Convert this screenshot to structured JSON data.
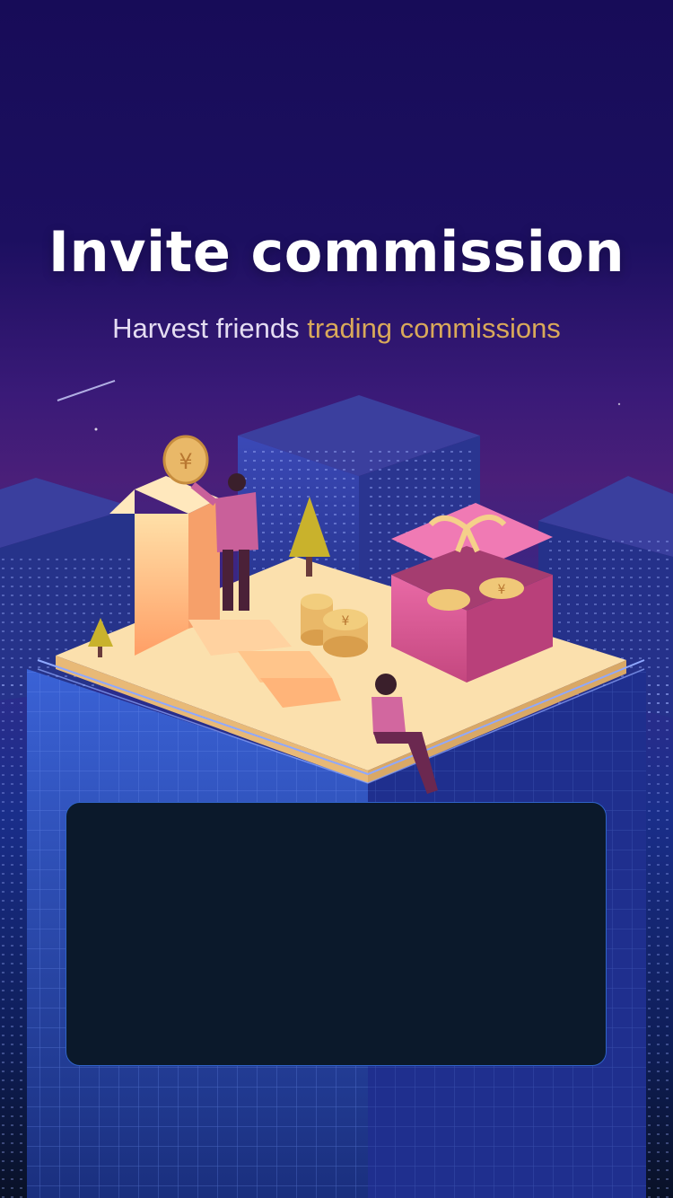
{
  "hero": {
    "title": "Invite commission",
    "subtitle_plain": "Harvest friends",
    "subtitle_accent": "trading commissions"
  },
  "illustration": {
    "icons": [
      "coin-icon",
      "gift-box-icon",
      "arrow-up-icon",
      "tree-icon",
      "building-icon"
    ],
    "coin_symbol": "¥"
  },
  "colors": {
    "background_top": "#170c58",
    "subtitle_accent": "#d9a95a",
    "card_background": "#0b192b",
    "card_border": "#2f63c7"
  }
}
